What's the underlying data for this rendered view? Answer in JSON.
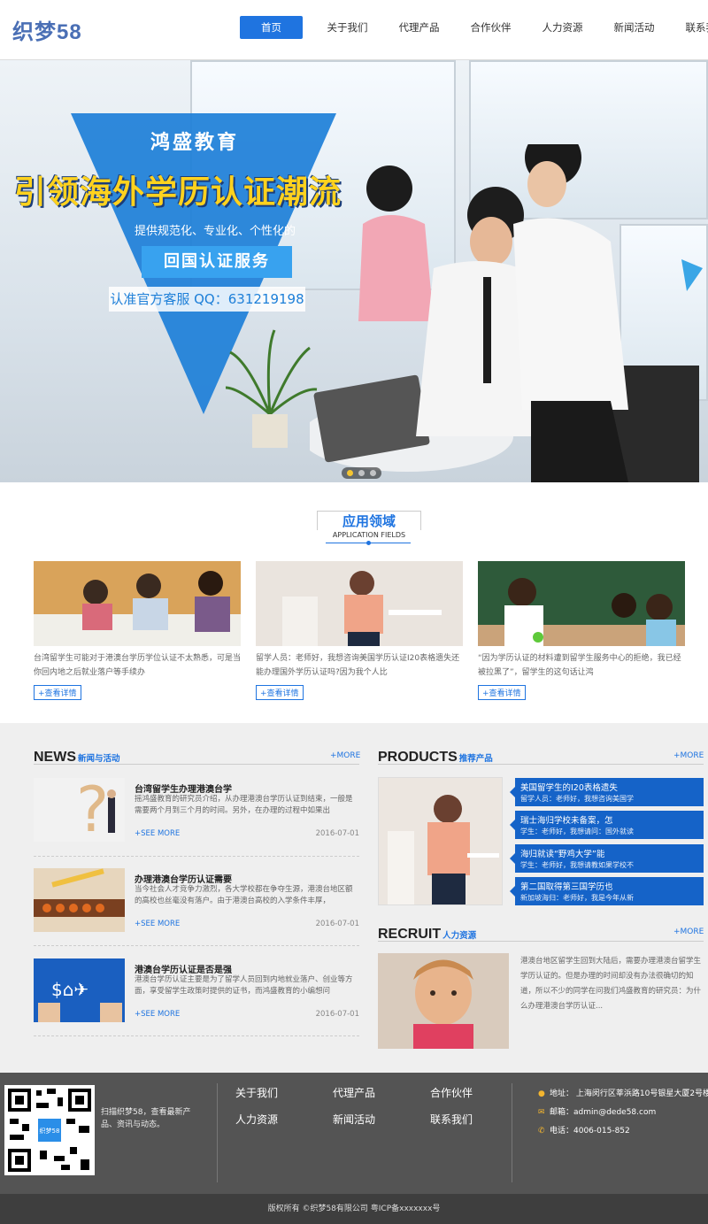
{
  "header": {
    "logo": "织梦58",
    "nav": [
      "首页",
      "关于我们",
      "代理产品",
      "合作伙伴",
      "人力资源",
      "新闻活动",
      "联系我们"
    ]
  },
  "banner": {
    "brand": "鸿盛教育",
    "headline": "引领海外学历认证潮流",
    "subline": "提供规范化、专业化、个性化的",
    "service": "回国认证服务",
    "qq": "认准官方客服 QQ：631219198",
    "slides": 3,
    "active_slide": 1
  },
  "fields": {
    "title_cn": "应用领域",
    "title_en": "APPLICATION FIELDS",
    "more_label": "+查看详情",
    "items": [
      {
        "text": "台湾留学生可能对于港澳台学历学位认证不太熟悉，可是当你回内地之后就业落户等手续办"
      },
      {
        "text": "留学人员：老师好，我想咨询美国学历认证I20表格遗失还能办理国外学历认证吗?因为我个人比"
      },
      {
        "text": "“因为学历认证的材料遭到留学生服务中心的拒绝，我已经被拉黑了”，留学生的这句话让鸿"
      }
    ]
  },
  "news": {
    "en": "NEWS",
    "cn": "新闻与活动",
    "more": "+MORE",
    "see_more": "+SEE MORE",
    "items": [
      {
        "title": "台湾留学生办理港澳台学",
        "desc": "摇鸿盛教育的研究员介绍，从办理港澳台学历认证到结束，一般是需要两个月到三个月的时间。另外，在办理的过程中如果出",
        "date": "2016-07-01"
      },
      {
        "title": "办理港澳台学历认证需要",
        "desc": "当今社会人才竞争力激烈，各大学校都在争夺生源，港澳台地区额的高校也丝毫没有落户。由于港澳台高校的入学条件丰厚，",
        "date": "2016-07-01"
      },
      {
        "title": "港澳台学历认证是否是强",
        "desc": "港澳台学历认证主要是为了留学人员回到内地就业落户、创业等方面，享受留学生政策时提供的证书，而鸿盛教育的小编想问",
        "date": "2016-07-01"
      }
    ]
  },
  "products": {
    "en": "PRODUCTS",
    "cn": "推荐产品",
    "more": "+MORE",
    "items": [
      {
        "title": "美国留学生的I20表格遗失",
        "desc": "留学人员：老师好，我想咨询美国学"
      },
      {
        "title": "瑞士海归学校未备案，怎",
        "desc": "学生：老师好，我想请问：国外就读"
      },
      {
        "title": "海归就读“野鸡大学”能",
        "desc": "学生：老师好，我想请教如果学校不"
      },
      {
        "title": "第二国取得第三国学历也",
        "desc": "新加坡海归：老师好，我是今年从新"
      }
    ]
  },
  "recruit": {
    "en": "RECRUIT",
    "cn": "人力资源",
    "more": "+MORE",
    "text": "港澳台地区留学生回到大陆后，需要办理港澳台留学生学历认证的。但是办理的时间却没有办法很确切的知道，所以不少的同学在问我们鸿盛教育的研究员：为什么办理港澳台学历认证..."
  },
  "footer": {
    "qr_caption": "扫描织梦58，查看最新产品、资讯与动态。",
    "links": [
      "关于我们",
      "代理产品",
      "合作伙伴",
      "人力资源",
      "新闻活动",
      "联系我们"
    ],
    "address": "地址： 上海闵行区莘浜路10号银星大厦2号楼",
    "email": "邮箱：admin@dede58.com",
    "phone": "电话：4006-015-852",
    "copyright": "版权所有 ©织梦58有限公司   粤ICP备xxxxxxx号"
  },
  "colors": {
    "accent": "#1f74e0",
    "product_bar": "#1563c8",
    "footer": "#545454",
    "gray_bg": "#efefef"
  }
}
